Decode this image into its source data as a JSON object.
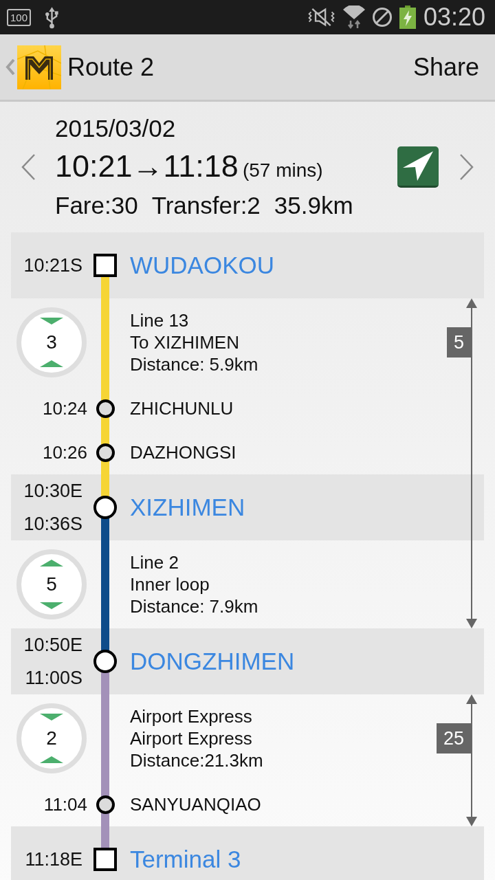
{
  "status_bar": {
    "badge_text": "100",
    "time": "03:20"
  },
  "action_bar": {
    "title": "Route 2",
    "action": "Share"
  },
  "summary": {
    "date": "2015/03/02",
    "times": "10:21→11:18",
    "duration": "(57 mins)",
    "stats": [
      "Fare:30",
      "Transfer:2",
      "35.9km"
    ]
  },
  "timeline": [
    {
      "kind": "station",
      "times": [
        "10:21S"
      ],
      "name": "WUDAOKOU",
      "transfer": false,
      "span_arrow": false
    },
    {
      "kind": "segment",
      "color": "#f6d535",
      "badge": {
        "count": "3",
        "arrows_inward": true
      },
      "info": [
        "Line 13",
        "To XIZHIMEN",
        "Distance: 5.9km"
      ],
      "stops": [
        {
          "time": "10:24",
          "name": "ZHICHUNLU"
        },
        {
          "time": "10:26",
          "name": "DAZHONGSI"
        }
      ],
      "span_arrow": true,
      "span_label": "5"
    },
    {
      "kind": "station",
      "times": [
        "10:30E",
        "10:36S"
      ],
      "name": "XIZHIMEN",
      "transfer": true,
      "span_arrow": true
    },
    {
      "kind": "segment",
      "color": "#0e4c8a",
      "badge": {
        "count": "5",
        "arrows_inward": false
      },
      "info": [
        "Line 2",
        "Inner loop",
        "Distance: 7.9km"
      ],
      "span_arrow": true
    },
    {
      "kind": "station",
      "times": [
        "10:50E",
        "11:00S"
      ],
      "name": "DONGZHIMEN",
      "transfer": true,
      "span_arrow": false
    },
    {
      "kind": "segment",
      "color": "#a391b9",
      "badge": {
        "count": "2",
        "arrows_inward": true
      },
      "info": [
        "Airport Express",
        "Airport Express",
        "Distance:21.3km"
      ],
      "stops": [
        {
          "time": "11:04",
          "name": "SANYUANQIAO"
        }
      ],
      "span_arrow": true,
      "span_label": "25"
    },
    {
      "kind": "station",
      "times": [
        "11:18E"
      ],
      "name": "Terminal 3",
      "transfer": false,
      "span_arrow": false
    }
  ]
}
